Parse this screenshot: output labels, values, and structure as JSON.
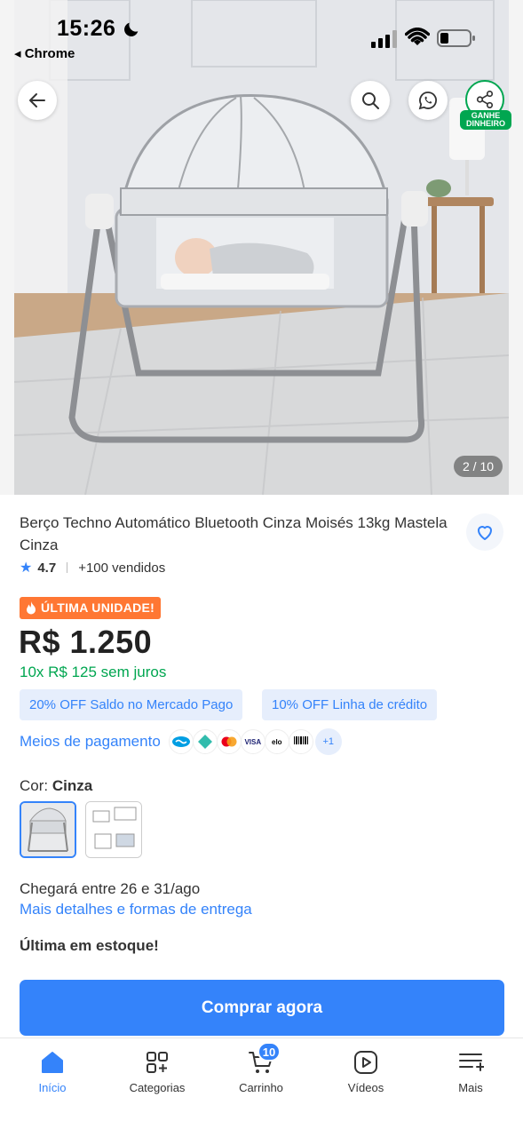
{
  "status_bar": {
    "time": "15:26",
    "back_app": "◂ Chrome"
  },
  "top_actions": {
    "share_label": "GANHE DINHEIRO"
  },
  "gallery": {
    "counter": "2 / 10"
  },
  "product": {
    "title": "Berço Techno Automático Bluetooth Cinza Moisés 13kg Mastela Cinza",
    "rating": "4.7",
    "sold": "+100 vendidos",
    "badge": "ÚLTIMA UNIDADE!",
    "price": "R$ 1.250",
    "installments": "10x R$ 125 sem juros"
  },
  "promos": [
    "20% OFF Saldo no Mercado Pago",
    "10% OFF Linha de crédito"
  ],
  "payment": {
    "link": "Meios de pagamento",
    "icons": [
      "mercado-pago-icon",
      "pix-icon",
      "mastercard-icon",
      "visa-icon",
      "elo-icon",
      "boleto-icon"
    ],
    "more": "+1"
  },
  "color": {
    "label": "Cor: ",
    "value": "Cinza"
  },
  "delivery": {
    "text": "Chegará entre 26 e 31/ago",
    "link": "Mais detalhes e formas de entrega"
  },
  "stock": "Última em estoque!",
  "buy_button": "Comprar agora",
  "tabs": [
    {
      "label": "Início",
      "active": true
    },
    {
      "label": "Categorias"
    },
    {
      "label": "Carrinho",
      "badge": "10"
    },
    {
      "label": "Vídeos"
    },
    {
      "label": "Mais"
    }
  ],
  "colors": {
    "accent": "#3483fa",
    "green": "#00a650",
    "orange": "#ff7733"
  }
}
